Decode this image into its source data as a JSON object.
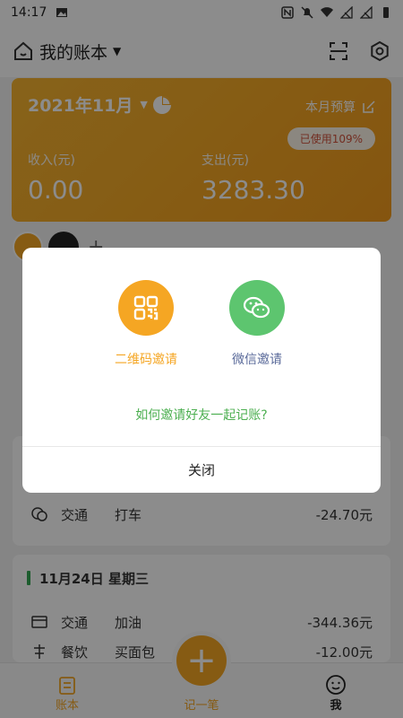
{
  "status": {
    "time": "14:17"
  },
  "appbar": {
    "title": "我的账本"
  },
  "card": {
    "month": "2021年11月",
    "budget_label": "本月预算",
    "used_label": "已使用109%",
    "income_label": "收入(元)",
    "income_value": "0.00",
    "expense_label": "支出(元)",
    "expense_value": "3283.30"
  },
  "records": {
    "row1": {
      "category": "交通",
      "note": "打车",
      "amount": "-24.70元"
    },
    "day2": {
      "date": "11月24日 星期三"
    },
    "row2": {
      "category": "交通",
      "note": "加油",
      "amount": "-344.36元"
    },
    "row3": {
      "category": "餐饮",
      "note": "买面包",
      "amount": "-12.00元"
    }
  },
  "tabs": {
    "book": "账本",
    "record": "记一笔",
    "me": "我"
  },
  "dialog": {
    "qr_label": "二维码邀请",
    "wechat_label": "微信邀请",
    "howto": "如何邀请好友一起记账?",
    "close": "关闭"
  },
  "colors": {
    "accent": "#f5a623",
    "wechat": "#5dc56f",
    "overlay": "rgba(0,0,0,0.45)"
  }
}
